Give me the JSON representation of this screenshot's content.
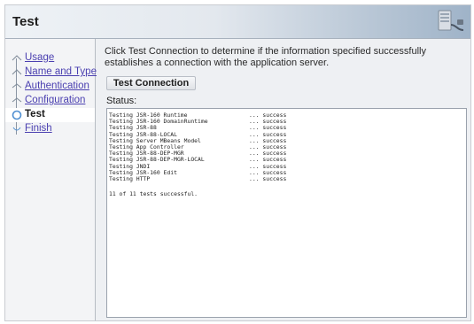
{
  "header": {
    "title": "Test"
  },
  "sidebar": {
    "steps": [
      {
        "label": "Usage"
      },
      {
        "label": "Name and Type"
      },
      {
        "label": "Authentication"
      },
      {
        "label": "Configuration"
      },
      {
        "label": "Test"
      },
      {
        "label": "Finish"
      }
    ]
  },
  "content": {
    "description": "Click Test Connection to determine if the information specified successfully establishes a connection with the application server.",
    "test_button": "Test Connection",
    "status_label": "Status:",
    "results": [
      {
        "name": "Testing JSR-160 Runtime",
        "result": "... success"
      },
      {
        "name": "Testing JSR-160 DomainRuntime",
        "result": "... success"
      },
      {
        "name": "Testing JSR-88",
        "result": "... success"
      },
      {
        "name": "Testing JSR-88-LOCAL",
        "result": "... success"
      },
      {
        "name": "Testing Server MBeans Model",
        "result": "... success"
      },
      {
        "name": "Testing App Controller",
        "result": "... success"
      },
      {
        "name": "Testing JSR-88-DEP-MGR",
        "result": "... success"
      },
      {
        "name": "Testing JSR-88-DEP-MGR-LOCAL",
        "result": "... success"
      },
      {
        "name": "Testing JNDI",
        "result": "... success"
      },
      {
        "name": "Testing JSR-160 Edit",
        "result": "... success"
      },
      {
        "name": "Testing HTTP",
        "result": "... success"
      }
    ],
    "summary": "11 of 11 tests successful."
  }
}
